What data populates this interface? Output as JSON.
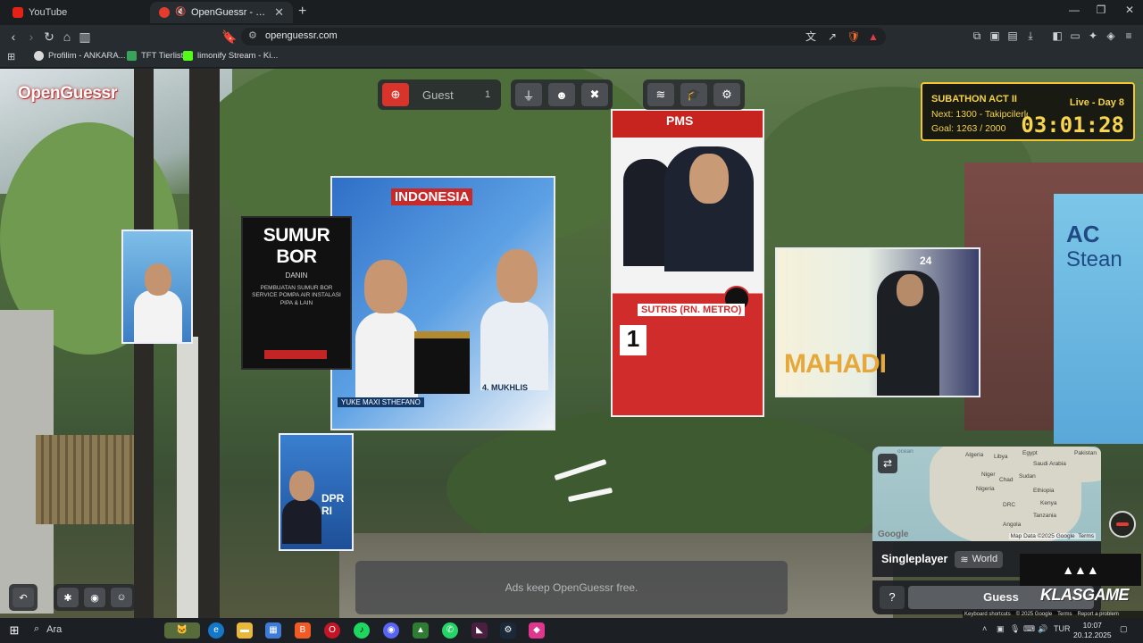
{
  "browser": {
    "tabs": [
      {
        "label": "YouTube",
        "favicon_color": "#e62117",
        "active": false
      },
      {
        "label": "OpenGuessr - Free GeoGuessr",
        "favicon_color": "#e33b2e",
        "active": true
      }
    ],
    "new_tab_icon": "+",
    "url": "openguessr.com",
    "bookmarks": [
      {
        "label": "Profilim - ANKARA...",
        "icon_color": "#d9d9d9"
      },
      {
        "label": "TFT Tierlist",
        "icon_color": "#3aa35b"
      },
      {
        "label": "limonify Stream - Ki...",
        "icon_color": "#53fc18"
      }
    ]
  },
  "scene": {
    "signs": {
      "sumur_title": "SUMUR BOR",
      "sumur_sub": "DANIN",
      "sumur_body": "PEMBUATAN SUMUR BOR SERVICE POMPA AIR INSTALASI PIPA & LAIN",
      "indo_title": "INDONESIA",
      "indo_name_left": "YUKE MAXI STHEFANO",
      "indo_name_right": "4. MUKHLIS",
      "sutris_header": "PMS",
      "sutris_name": "SUTRIS (RN. METRO)",
      "sutris_number": "1",
      "mahadi_name": "MAHADI",
      "mahadi_number": "24",
      "dpr": "DPR RI",
      "steam_top": "AC",
      "steam_word": "Stean"
    }
  },
  "game": {
    "logo": "OpenGuessr",
    "guest_label": "Guest",
    "guest_count": "1",
    "ad_text": "Ads keep OpenGuessr free.",
    "mode_label": "Singleplayer",
    "map_label": "World",
    "help_label": "?",
    "guess_label": "Guess",
    "minimap": {
      "labels": [
        "Algeria",
        "Libya",
        "Egypt",
        "Saudi Arabia",
        "Pakistan",
        "Niger",
        "Chad",
        "Sudan",
        "Nigeria",
        "Ethiopia",
        "Kenya",
        "DRC",
        "Tanzania",
        "Angola"
      ],
      "ocean_label": "ocean",
      "google": "Google",
      "map_data": "Map Data ©2025 Google",
      "terms": "Terms"
    },
    "google_footer": [
      "Keyboard shortcuts",
      "© 2025 Google",
      "Terms",
      "Report a problem"
    ]
  },
  "stream_overlay": {
    "title": "SUBATHON ACT II",
    "next": "Next: 1300 - Takipcilerle",
    "goal": "Goal: 1263 / 2000",
    "live": "Live - Day 8",
    "timer": "03:01:28",
    "sponsor": "KLASGAME",
    "sponsor_a": "KLAS",
    "sponsor_b": "GAME"
  },
  "taskbar": {
    "search": "Ara",
    "lang": "TUR",
    "time": "10:07",
    "date": "20.12.2025"
  },
  "colors": {
    "accent_red": "#d8342c",
    "overlay_yellow": "#f2c72e"
  }
}
